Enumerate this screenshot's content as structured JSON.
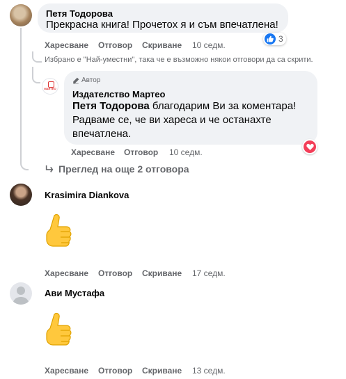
{
  "comments": [
    {
      "author": "Петя Тодорова",
      "text": "Прекрасна книга! Прочетох я и съм впечатлена!",
      "reaction_count": "3",
      "actions": {
        "like": "Харесване",
        "reply": "Отговор",
        "hide": "Скриване",
        "time": "10 седм."
      }
    },
    {
      "author": "Krasimira Diankova",
      "actions": {
        "like": "Харесване",
        "reply": "Отговор",
        "hide": "Скриване",
        "time": "17 седм."
      }
    },
    {
      "author": "Ави Мустафа",
      "actions": {
        "like": "Харесване",
        "reply": "Отговор",
        "hide": "Скриване",
        "time": "13 седм."
      }
    }
  ],
  "filter_notice": "Избрано е \"Най-уместни\", така че е възможно някои отговори да са скрити.",
  "reply": {
    "badge": "Автор",
    "author": "Издателство Мартео",
    "avatar_text": "MARTEO",
    "mention": "Петя Тодорова",
    "text": " благодарим Ви за коментара! Радваме се, че ви хареса и че останахте впечатлена.",
    "actions": {
      "like": "Харесване",
      "reply": "Отговор",
      "time": "10 седм."
    }
  },
  "more_replies": "Преглед на още 2 отговора",
  "colors": {
    "like_blue": "#1877f2",
    "love_red": "#f33e58",
    "muted": "#65676b",
    "bubble": "#f0f2f5"
  },
  "icons": [
    "pencil-icon",
    "reply-arrow-icon",
    "thumbs-up-icon",
    "heart-icon",
    "default-avatar-icon",
    "thumbs-up-emoji-icon"
  ]
}
